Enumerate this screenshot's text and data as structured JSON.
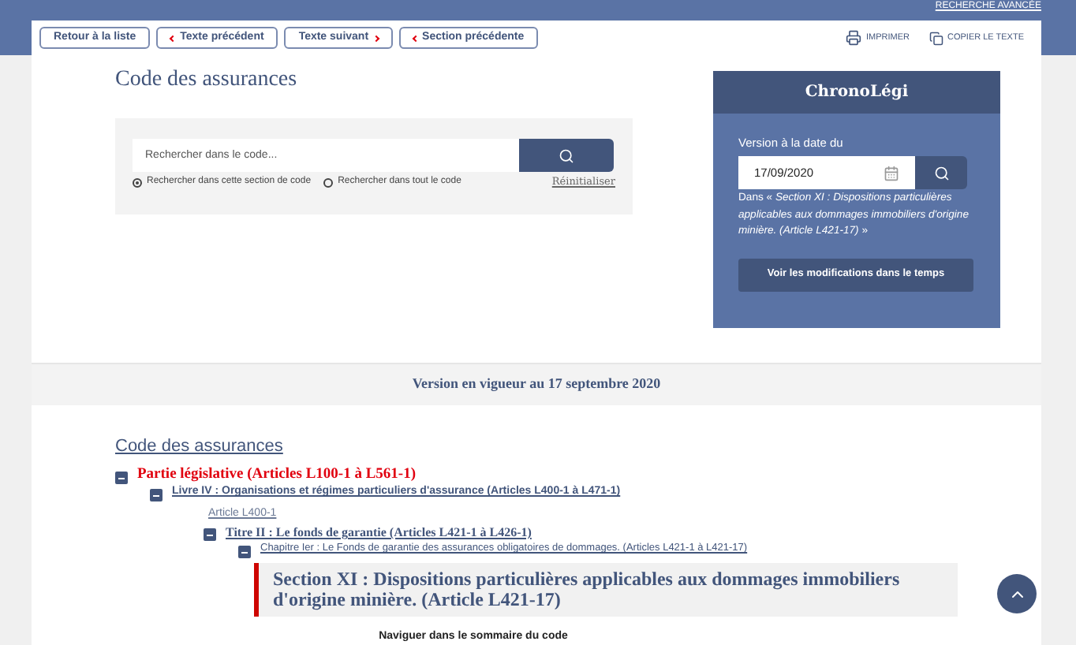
{
  "header_link": "RECHERCHE AVANCÉE",
  "toolbar": {
    "nav_buttons": [
      {
        "label": "Retour à la liste",
        "kind": "plain"
      },
      {
        "label": "Texte précédent",
        "kind": "prev"
      },
      {
        "label": "Texte suivant",
        "kind": "next"
      },
      {
        "label": "Section précédente",
        "kind": "prev"
      }
    ],
    "actions": [
      {
        "label": "IMPRIMER",
        "kind": "print"
      },
      {
        "label": "COPIER LE TEXTE",
        "kind": "copy"
      }
    ]
  },
  "title": "Code des assurances",
  "search": {
    "placeholder": "Rechercher dans le code...",
    "scopes": [
      {
        "label": "Rechercher dans cette section de code",
        "selected": true
      },
      {
        "label": "Rechercher dans tout le code",
        "selected": false
      }
    ],
    "reset": "Réinitialiser"
  },
  "chronolegi": {
    "title": "ChronoLégi",
    "date_label": "Version à la date du",
    "date": "17/09/2020",
    "context": "Dans « *Section XI : Dispositions particulières applicables aux dommages immobiliers d'origine minière. (Article L421-17)* »",
    "button": "Voir les modifications dans le temps"
  },
  "version_banner": "Version en vigueur au 17 septembre 2020",
  "toc": {
    "title": "Code des assurances",
    "items": [
      {
        "label": "Partie législative (Articles L100-1 à L561-1)",
        "kind": "part",
        "expanded": true,
        "children": [
          {
            "label": "Livre IV : Organisations et régimes particuliers d'assurance (Articles L400-1 à L471-1)",
            "kind": "book",
            "expanded": true,
            "children": [
              {
                "label": "Article L400-1",
                "kind": "article"
              },
              {
                "label": "Titre II : Le fonds de garantie (Articles L421-1 à L426-1)",
                "kind": "title",
                "expanded": true,
                "children": [
                  {
                    "label": "Chapitre Ier : Le Fonds de garantie des assurances obligatoires de dommages. (Articles L421-1 à L421-17)",
                    "kind": "chapter",
                    "expanded": true,
                    "children": [
                      {
                        "label": "Section XI : Dispositions particulières applicables aux dommages immobiliers d'origine minière. (Article L421-17)",
                        "kind": "current"
                      }
                    ]
                  }
                ]
              }
            ]
          }
        ]
      }
    ]
  },
  "footer_nav": "Naviguer dans le sommaire du code"
}
